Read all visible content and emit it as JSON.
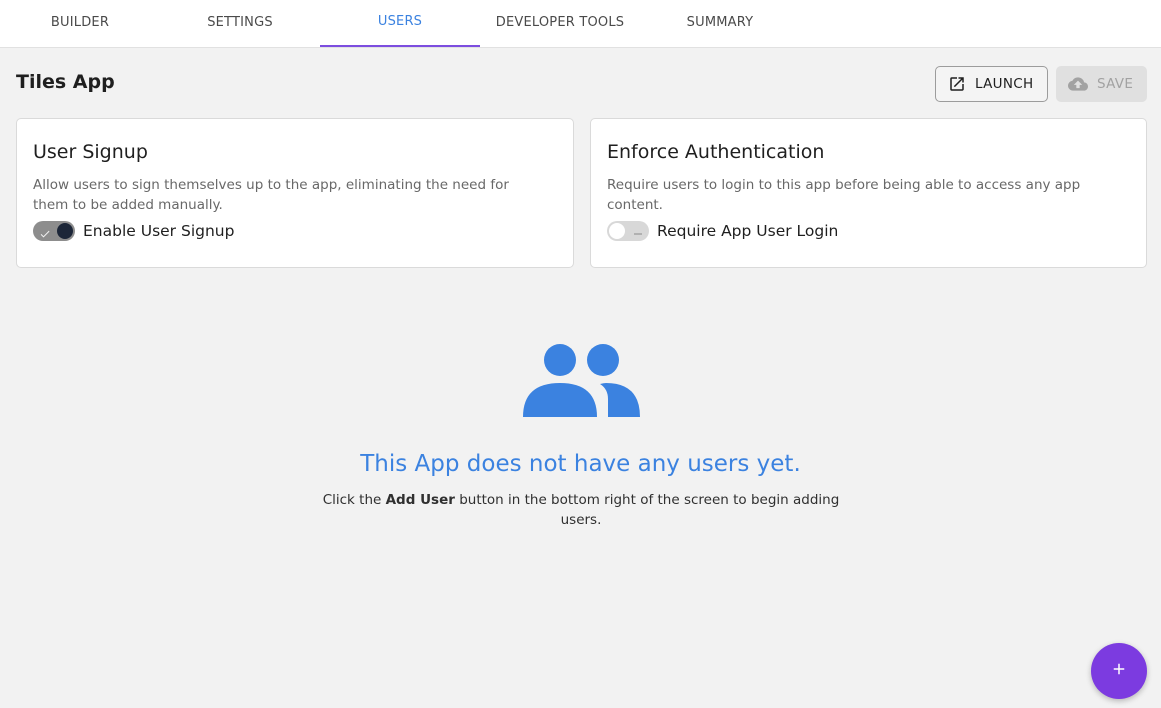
{
  "tabs": [
    {
      "label": "BUILDER",
      "active": false
    },
    {
      "label": "SETTINGS",
      "active": false
    },
    {
      "label": "USERS",
      "active": true
    },
    {
      "label": "DEVELOPER TOOLS",
      "active": false
    },
    {
      "label": "SUMMARY",
      "active": false
    }
  ],
  "header": {
    "app_title": "Tiles App",
    "launch_label": "LAUNCH",
    "launch_icon": "external-link-icon",
    "save_label": "SAVE",
    "save_icon": "cloud-upload-icon"
  },
  "cards": {
    "signup": {
      "title": "User Signup",
      "description": "Allow users to sign themselves up to the app, eliminating the need for them to be added manually.",
      "toggle_label": "Enable User Signup",
      "toggle_on": true
    },
    "auth": {
      "title": "Enforce Authentication",
      "description": "Require users to login to this app before being able to access any app content.",
      "toggle_label": "Require App User Login",
      "toggle_on": false
    }
  },
  "empty_state": {
    "icon": "group-users-icon",
    "title": "This App does not have any users yet.",
    "desc_prefix": "Click the ",
    "desc_bold": "Add User",
    "desc_suffix": " button in the bottom right of the screen to begin adding users."
  },
  "fab": {
    "icon": "plus-icon"
  },
  "colors": {
    "accent_blue": "#3b82e0",
    "accent_purple": "#7c3be0",
    "tab_indicator": "#7c4ddf"
  }
}
